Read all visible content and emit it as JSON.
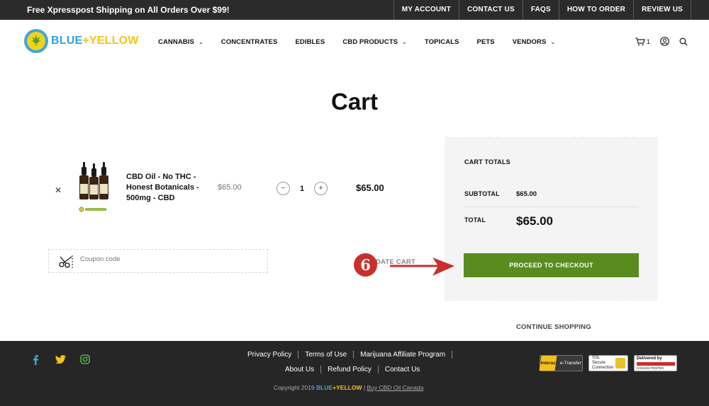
{
  "topbar": {
    "promo": "Free Xpresspost Shipping on All Orders Over $99!",
    "links": [
      "MY ACCOUNT",
      "CONTACT US",
      "FAQS",
      "HOW TO ORDER",
      "REVIEW US"
    ]
  },
  "header": {
    "logo": {
      "blue": "BLUE",
      "plus": "+",
      "yellow": "YELLOW"
    },
    "nav": [
      {
        "label": "CANNABIS",
        "dropdown": true
      },
      {
        "label": "CONCENTRATES",
        "dropdown": false
      },
      {
        "label": "EDIBLES",
        "dropdown": false
      },
      {
        "label": "CBD PRODUCTS",
        "dropdown": true
      },
      {
        "label": "TOPICALS",
        "dropdown": false
      },
      {
        "label": "PETS",
        "dropdown": false
      },
      {
        "label": "VENDORS",
        "dropdown": true
      }
    ],
    "cart_count": "1"
  },
  "page": {
    "title": "Cart"
  },
  "cart": {
    "item": {
      "name": "CBD Oil - No THC - Honest Botanicals - 500mg - CBD",
      "price": "$65.00",
      "quantity": "1",
      "subtotal": "$65.00"
    },
    "coupon_placeholder": "Coupon code",
    "update_label": "DATE CART"
  },
  "totals": {
    "heading": "CART TOTALS",
    "subtotal_label": "SUBTOTAL",
    "subtotal_value": "$65.00",
    "total_label": "TOTAL",
    "total_value": "$65.00",
    "checkout_label": "PROCEED TO CHECKOUT"
  },
  "continue_label": "CONTINUE SHOPPING",
  "annotation": {
    "number": "6",
    "color": "#c9302c"
  },
  "footer": {
    "social": [
      "facebook-icon",
      "twitter-icon",
      "instagram-icon"
    ],
    "links_row1": [
      "Privacy Policy",
      "Terms of Use",
      "Marijuana Affiliate Program"
    ],
    "links_row2": [
      "About Us",
      "Refund Policy",
      "Contact Us"
    ],
    "copyright_prefix": "Copyright 2019",
    "copyright_brand_blue": "BLUE",
    "copyright_brand_plus": "+",
    "copyright_brand_yellow": "YELLOW",
    "copyright_sep": "|",
    "copyright_link": "Buy CBD Oil Canada",
    "badges": {
      "interac": "Interac",
      "etransfer": "e-Transfer",
      "ssl_line1": "SSL",
      "ssl_line2": "Secure",
      "ssl_line3": "Connection",
      "cp_line1": "Delivered by",
      "cp_line2": "CANADA POSTES"
    }
  },
  "colors": {
    "accent_green": "#5a8b1f",
    "brand_blue": "#3aa7de",
    "brand_yellow": "#f0c51a",
    "dark_bar": "#2b2b2b"
  }
}
